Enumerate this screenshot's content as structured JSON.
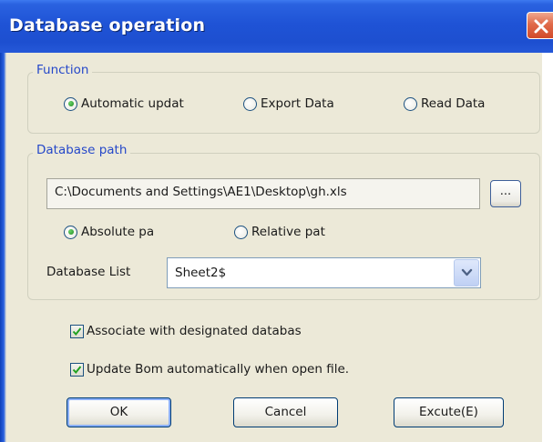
{
  "window": {
    "title": "Database operation"
  },
  "function_group": {
    "legend": "Function",
    "options": [
      {
        "label": "Automatic updat",
        "checked": true
      },
      {
        "label": "Export Data",
        "checked": false
      },
      {
        "label": "Read Data",
        "checked": false
      }
    ]
  },
  "path_group": {
    "legend": "Database path",
    "path_value": "C:\\Documents and Settings\\AE1\\Desktop\\gh.xls",
    "browse_label": "...",
    "path_modes": [
      {
        "label": "Absolute pa",
        "checked": true
      },
      {
        "label": "Relative pat",
        "checked": false
      }
    ],
    "list_label": "Database List",
    "list_selected": "Sheet2$"
  },
  "options": [
    {
      "label": "Associate with designated databas",
      "checked": true
    },
    {
      "label": "Update Bom automatically when open file.",
      "checked": true
    }
  ],
  "buttons": {
    "ok": "OK",
    "cancel": "Cancel",
    "execute": "Excute(E)"
  },
  "colors": {
    "titlebar": "#1f53d6",
    "dialog_bg": "#ece9d8",
    "legend_text": "#2548c9",
    "close_button": "#d24a2a"
  },
  "icons": {
    "close": "close-icon",
    "dropdown": "chevron-down-icon",
    "check": "check-icon"
  }
}
